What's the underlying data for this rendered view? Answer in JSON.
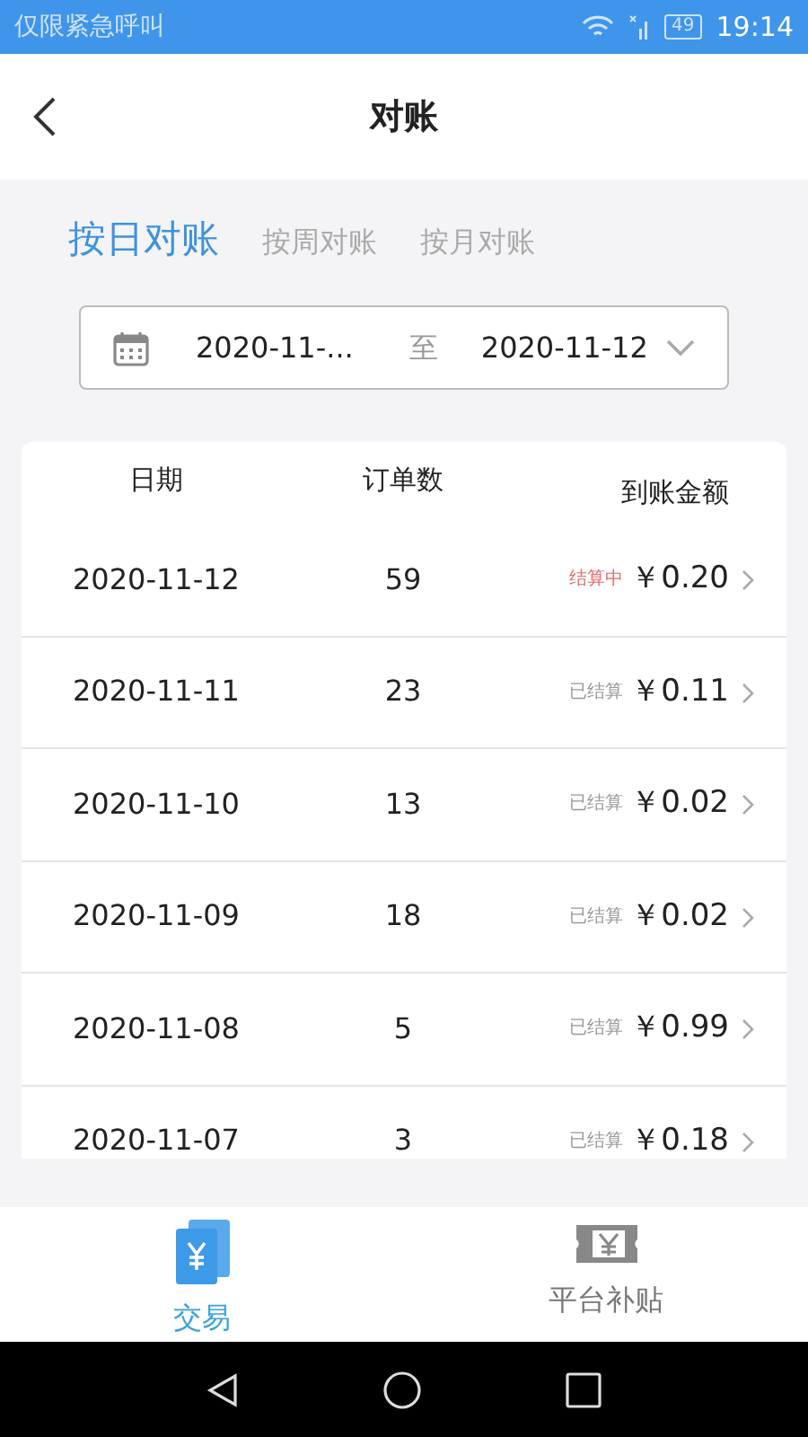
{
  "status_bar": {
    "carrier": "仅限紧急呼叫",
    "battery": "49",
    "time": "19:14"
  },
  "header": {
    "title": "对账"
  },
  "tabs": [
    {
      "label": "按日对账",
      "selected": true
    },
    {
      "label": "按周对账",
      "selected": false
    },
    {
      "label": "按月对账",
      "selected": false
    }
  ],
  "date_range": {
    "start": "2020-11-...",
    "separator": "至",
    "end": "2020-11-12"
  },
  "table": {
    "columns": [
      "日期",
      "订单数",
      "到账金额"
    ],
    "rows": [
      {
        "date": "2020-11-12",
        "orders": "59",
        "status": "结算中",
        "kind": "pending",
        "amount": "￥0.20"
      },
      {
        "date": "2020-11-11",
        "orders": "23",
        "status": "已结算",
        "kind": "settled",
        "amount": "￥0.11"
      },
      {
        "date": "2020-11-10",
        "orders": "13",
        "status": "已结算",
        "kind": "settled",
        "amount": "￥0.02"
      },
      {
        "date": "2020-11-09",
        "orders": "18",
        "status": "已结算",
        "kind": "settled",
        "amount": "￥0.02"
      },
      {
        "date": "2020-11-08",
        "orders": "5",
        "status": "已结算",
        "kind": "settled",
        "amount": "￥0.99"
      },
      {
        "date": "2020-11-07",
        "orders": "3",
        "status": "已结算",
        "kind": "settled",
        "amount": "￥0.18"
      }
    ]
  },
  "bottom_nav": [
    {
      "label": "交易",
      "selected": true
    },
    {
      "label": "平台补贴",
      "selected": false
    }
  ]
}
